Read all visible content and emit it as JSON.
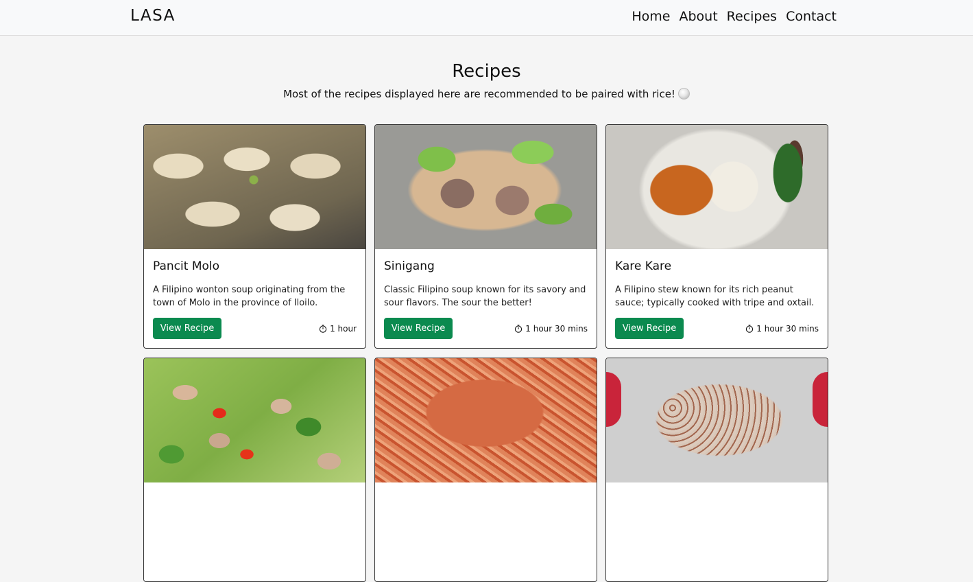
{
  "navbar": {
    "brand": "LASA",
    "links": [
      {
        "label": "Home"
      },
      {
        "label": "About"
      },
      {
        "label": "Recipes"
      },
      {
        "label": "Contact"
      }
    ]
  },
  "header": {
    "title": "Recipes",
    "subtitle": "Most of the recipes displayed here are recommended to be paired with rice!"
  },
  "recipes": [
    {
      "title": "Pancit Molo",
      "description": "A Filipino wonton soup originating from the town of Molo in the province of Iloilo.",
      "button": "View Recipe",
      "time": "1 hour"
    },
    {
      "title": "Sinigang",
      "description": "Classic Filipino soup known for its savory and sour flavors. The sour the better!",
      "button": "View Recipe",
      "time": "1 hour 30 mins"
    },
    {
      "title": "Kare Kare",
      "description": "A Filipino stew known for its rich peanut sauce; typically cooked with tripe and oxtail.",
      "button": "View Recipe",
      "time": "1 hour 30 mins"
    },
    {
      "title": "",
      "description": "",
      "button": "",
      "time": ""
    },
    {
      "title": "",
      "description": "",
      "button": "",
      "time": ""
    },
    {
      "title": "",
      "description": "",
      "button": "",
      "time": ""
    }
  ],
  "colors": {
    "button_bg": "#0b8a4f",
    "navbar_bg": "#f8f9fa",
    "page_bg": "#f5f5f5"
  }
}
